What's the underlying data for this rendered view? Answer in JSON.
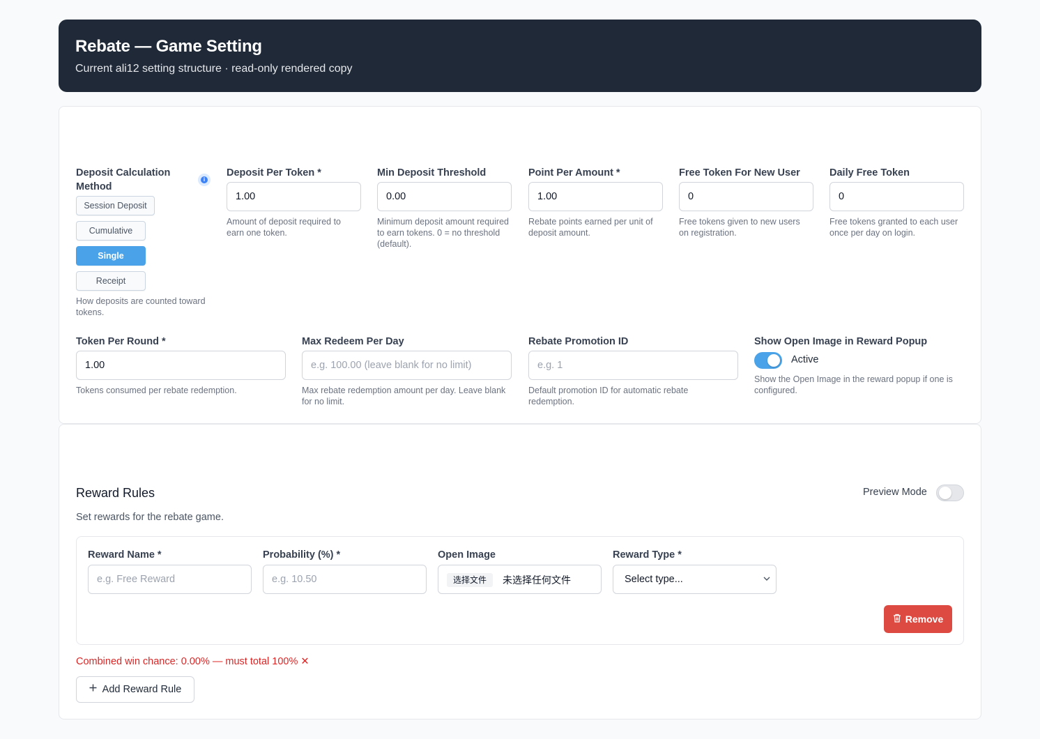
{
  "header": {
    "title": "Rebate — Game Setting",
    "subtitle": "Current ali12 setting structure · read-only rendered copy"
  },
  "settings": {
    "deposit_method": {
      "label": "Deposit Calculation Method",
      "options": [
        "Session Deposit",
        "Cumulative",
        "Single",
        "Receipt"
      ],
      "selected": "Single",
      "help": "How deposits are counted toward tokens."
    },
    "deposit_per_token": {
      "label": "Deposit Per Token *",
      "value": "1.00",
      "help": "Amount of deposit required to earn one token."
    },
    "min_deposit_threshold": {
      "label": "Min Deposit Threshold",
      "value": "0.00",
      "help": "Minimum deposit amount required to earn tokens. 0 = no threshold (default)."
    },
    "point_per_amount": {
      "label": "Point Per Amount *",
      "value": "1.00",
      "help": "Rebate points earned per unit of deposit amount."
    },
    "free_token_new_user": {
      "label": "Free Token For New User",
      "value": "0",
      "help": "Free tokens given to new users on registration."
    },
    "daily_free_token": {
      "label": "Daily Free Token",
      "value": "0",
      "help": "Free tokens granted to each user once per day on login."
    },
    "token_per_round": {
      "label": "Token Per Round *",
      "value": "1.00",
      "help": "Tokens consumed per rebate redemption."
    },
    "max_redeem_per_day": {
      "label": "Max Redeem Per Day",
      "placeholder": "e.g. 100.00 (leave blank for no limit)",
      "help": "Max rebate redemption amount per day. Leave blank for no limit."
    },
    "rebate_promotion_id": {
      "label": "Rebate Promotion ID",
      "placeholder": "e.g. 1",
      "help": "Default promotion ID for automatic rebate redemption."
    },
    "show_open_image": {
      "label": "Show Open Image in Reward Popup",
      "state": "Active",
      "enabled": true,
      "help": "Show the Open Image in the reward popup if one is configured."
    }
  },
  "reward_rules": {
    "title": "Reward Rules",
    "subtitle": "Set rewards for the rebate game.",
    "preview_mode_label": "Preview Mode",
    "preview_mode_enabled": false,
    "rule": {
      "name_label": "Reward Name *",
      "name_placeholder": "e.g. Free Reward",
      "probability_label": "Probability (%) *",
      "probability_placeholder": "e.g. 10.50",
      "open_image_label": "Open Image",
      "file_button": "选择文件",
      "file_status": "未选择任何文件",
      "reward_type_label": "Reward Type *",
      "reward_type_value": "Select type...",
      "remove_label": "Remove"
    },
    "combined_error": "Combined win chance: 0.00% — must total 100% ✕",
    "add_label": "Add Reward Rule"
  },
  "colors": {
    "header_bg": "#1f2937",
    "accent": "#4aa3e8",
    "danger": "#dc4a42",
    "error_text": "#dc2626"
  }
}
